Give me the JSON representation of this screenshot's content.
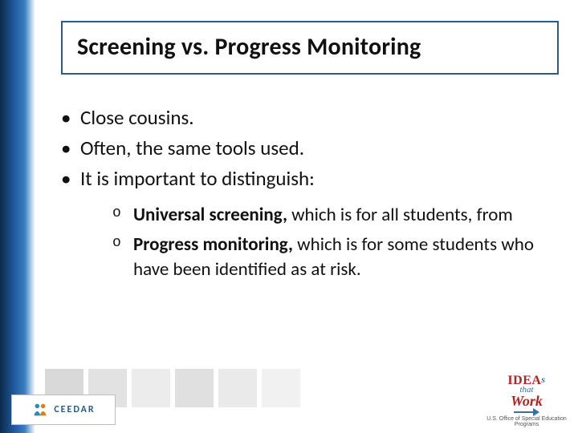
{
  "title": "Screening vs. Progress Monitoring",
  "bullets": [
    "Close cousins.",
    "Often, the same tools used.",
    "It is important to distinguish:"
  ],
  "sub": [
    {
      "bold": "Universal screening,",
      "rest": " which is for all students, from"
    },
    {
      "bold": "Progress monitoring,",
      "rest": " which is for some students who have been identified as at risk."
    }
  ],
  "logos": {
    "ceedar": "CEEDAR",
    "ideas_line1_a": "IDEA",
    "ideas_line1_b": "s",
    "ideas_line2": "that",
    "ideas_line3": "Work",
    "ideas_sub": "U.S. Office of Special Education Programs"
  }
}
